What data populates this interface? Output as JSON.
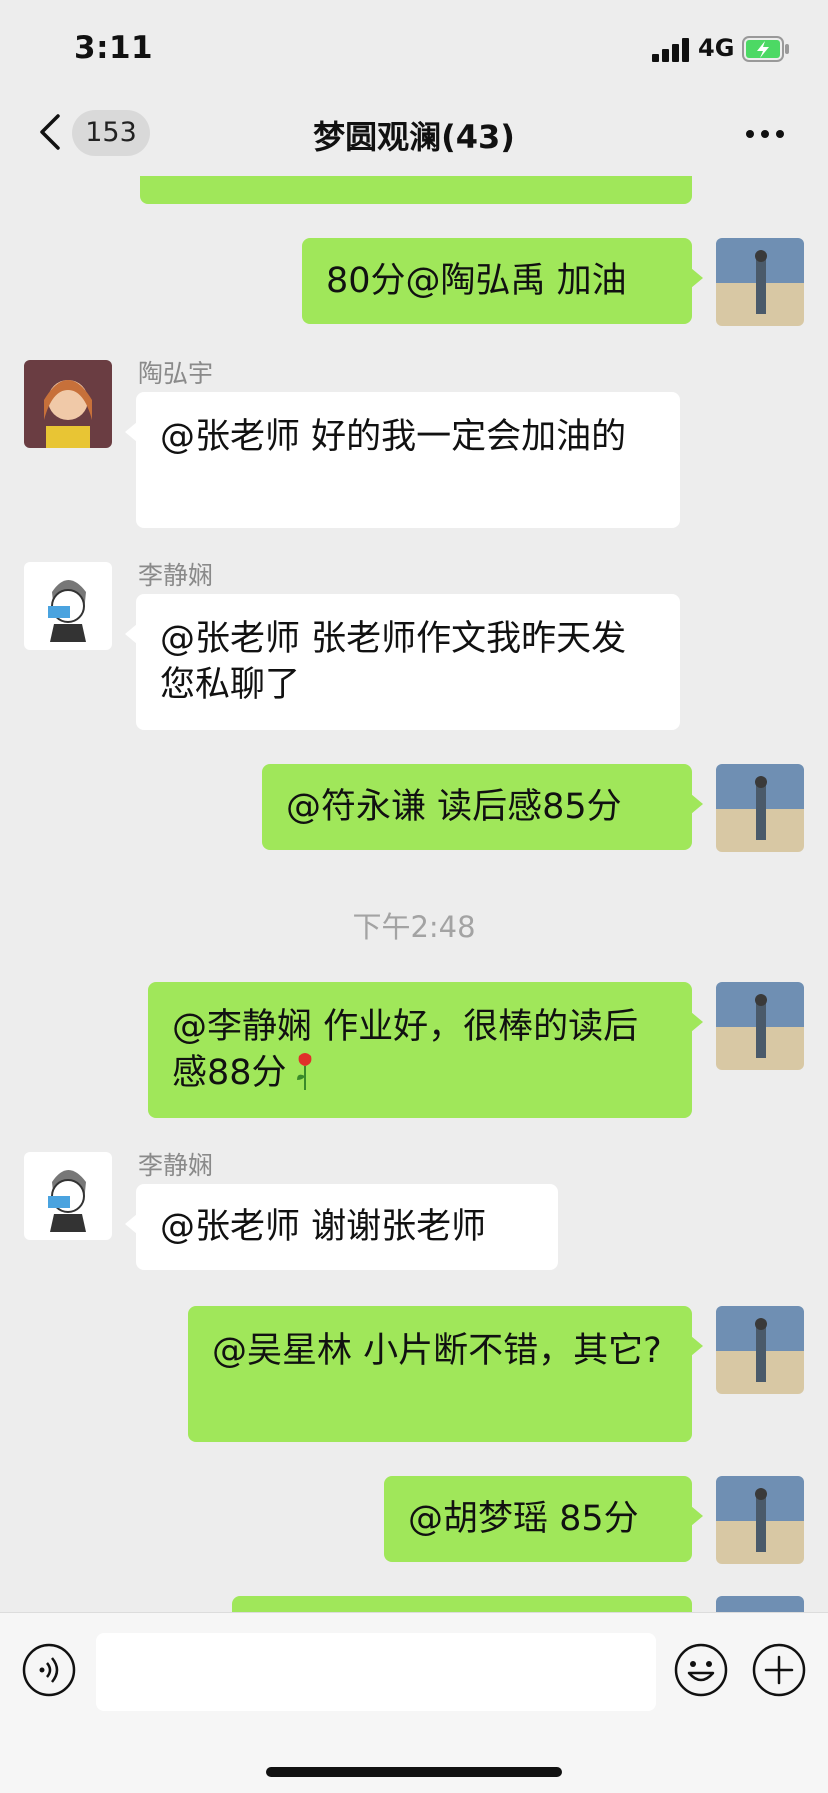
{
  "status_bar": {
    "time": "3:11",
    "network": "4G"
  },
  "header": {
    "back_count": "153",
    "title": "梦圆观澜(43)"
  },
  "messages": [
    {
      "type": "out",
      "text": "80分@陶弘禹 加油"
    },
    {
      "type": "in",
      "sender": "陶弘宇",
      "text": "@张老师 好的我一定会加油的"
    },
    {
      "type": "in",
      "sender": "李静娴",
      "text": "@张老师 张老师作文我昨天发您私聊了"
    },
    {
      "type": "out",
      "text": "@符永谦 读后感85分"
    },
    {
      "type": "time",
      "text": "下午2:48"
    },
    {
      "type": "out",
      "text": "@李静娴 作业好，很棒的读后感88分",
      "emoji": "rose"
    },
    {
      "type": "in",
      "sender": "李静娴",
      "text": "@张老师 谢谢张老师"
    },
    {
      "type": "out",
      "text": "@吴星林 小片断不错，其它?"
    },
    {
      "type": "out",
      "text": "@胡梦瑶 85分"
    }
  ],
  "icons": {
    "back": "chevron-left-icon",
    "more": "ellipsis-icon",
    "voice": "voice-icon",
    "emoji": "smiley-icon",
    "plus": "plus-icon"
  },
  "colors": {
    "outgoing_bubble": "#a0e75a",
    "incoming_bubble": "#ffffff",
    "background": "#ededed"
  }
}
